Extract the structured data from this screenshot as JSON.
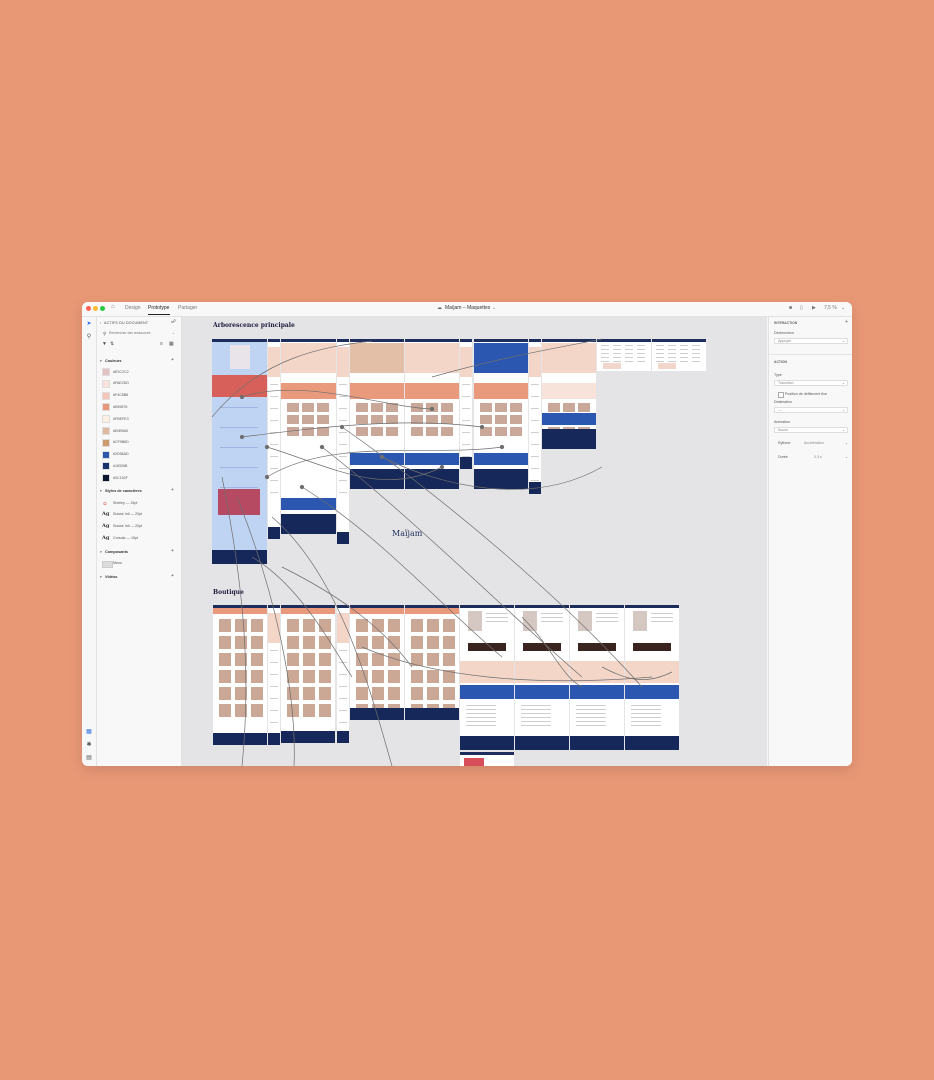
{
  "titlebar": {
    "tabs": [
      "Design",
      "Prototype",
      "Partager"
    ],
    "active_tab": "Prototype",
    "doc_title": "Maïjam – Maquettes",
    "zoom": "7,5 %"
  },
  "left_panel": {
    "section_title": "ACTIFS DU DOCUMENT",
    "search_placeholder": "Rechercher des ressources",
    "colors_header": "Couleurs",
    "colors": [
      {
        "label": "#E2C2C2",
        "hex": "#E2C2C2"
      },
      {
        "label": "#FAE2DD",
        "hex": "#FAE2DD"
      },
      {
        "label": "#F4C5B8",
        "hex": "#F4C5B8"
      },
      {
        "label": "#E89878",
        "hex": "#E89878"
      },
      {
        "label": "#FBEFE3",
        "hex": "#FBEFE3"
      },
      {
        "label": "#E0B9A0",
        "hex": "#E0B9A0"
      },
      {
        "label": "#CF9B6D",
        "hex": "#CF9B6D"
      },
      {
        "label": "#2D56AD",
        "hex": "#2D56AD"
      },
      {
        "label": "#18326B",
        "hex": "#18326B"
      },
      {
        "label": "#0C152F",
        "hex": "#0C152F"
      }
    ],
    "styles_header": "Styles de caractères",
    "styles": [
      {
        "sample": "",
        "label": "Shelley — 15pt"
      },
      {
        "sample": "Ag",
        "label": "Suisse Intl — 20pt"
      },
      {
        "sample": "Ag",
        "label": "Suisse Intl — 20pt"
      },
      {
        "sample": "Ag",
        "label": "Corsola — 15pt"
      }
    ],
    "components_header": "Composants",
    "components": [
      "Menu"
    ],
    "videos_header": "Vidéos"
  },
  "canvas": {
    "section1": "Arborescence principale",
    "section2": "Boutique",
    "logo": "Maïjam"
  },
  "right_panel": {
    "interaction_header": "INTERACTION",
    "trigger_label": "Déclencheur",
    "trigger_value": "Appuyer",
    "action_header": "ACTION",
    "type_label": "Type",
    "type_value": "Transition",
    "checkbox_label": "Position de défilement fixe",
    "dest_label": "Destination",
    "dest_value": "—",
    "anim_label": "Animation",
    "anim_value": "Aucun",
    "easing_label": "Rythme",
    "easing_value": "Accélération",
    "duration_label": "Durée",
    "duration_value": "0,3 s"
  }
}
